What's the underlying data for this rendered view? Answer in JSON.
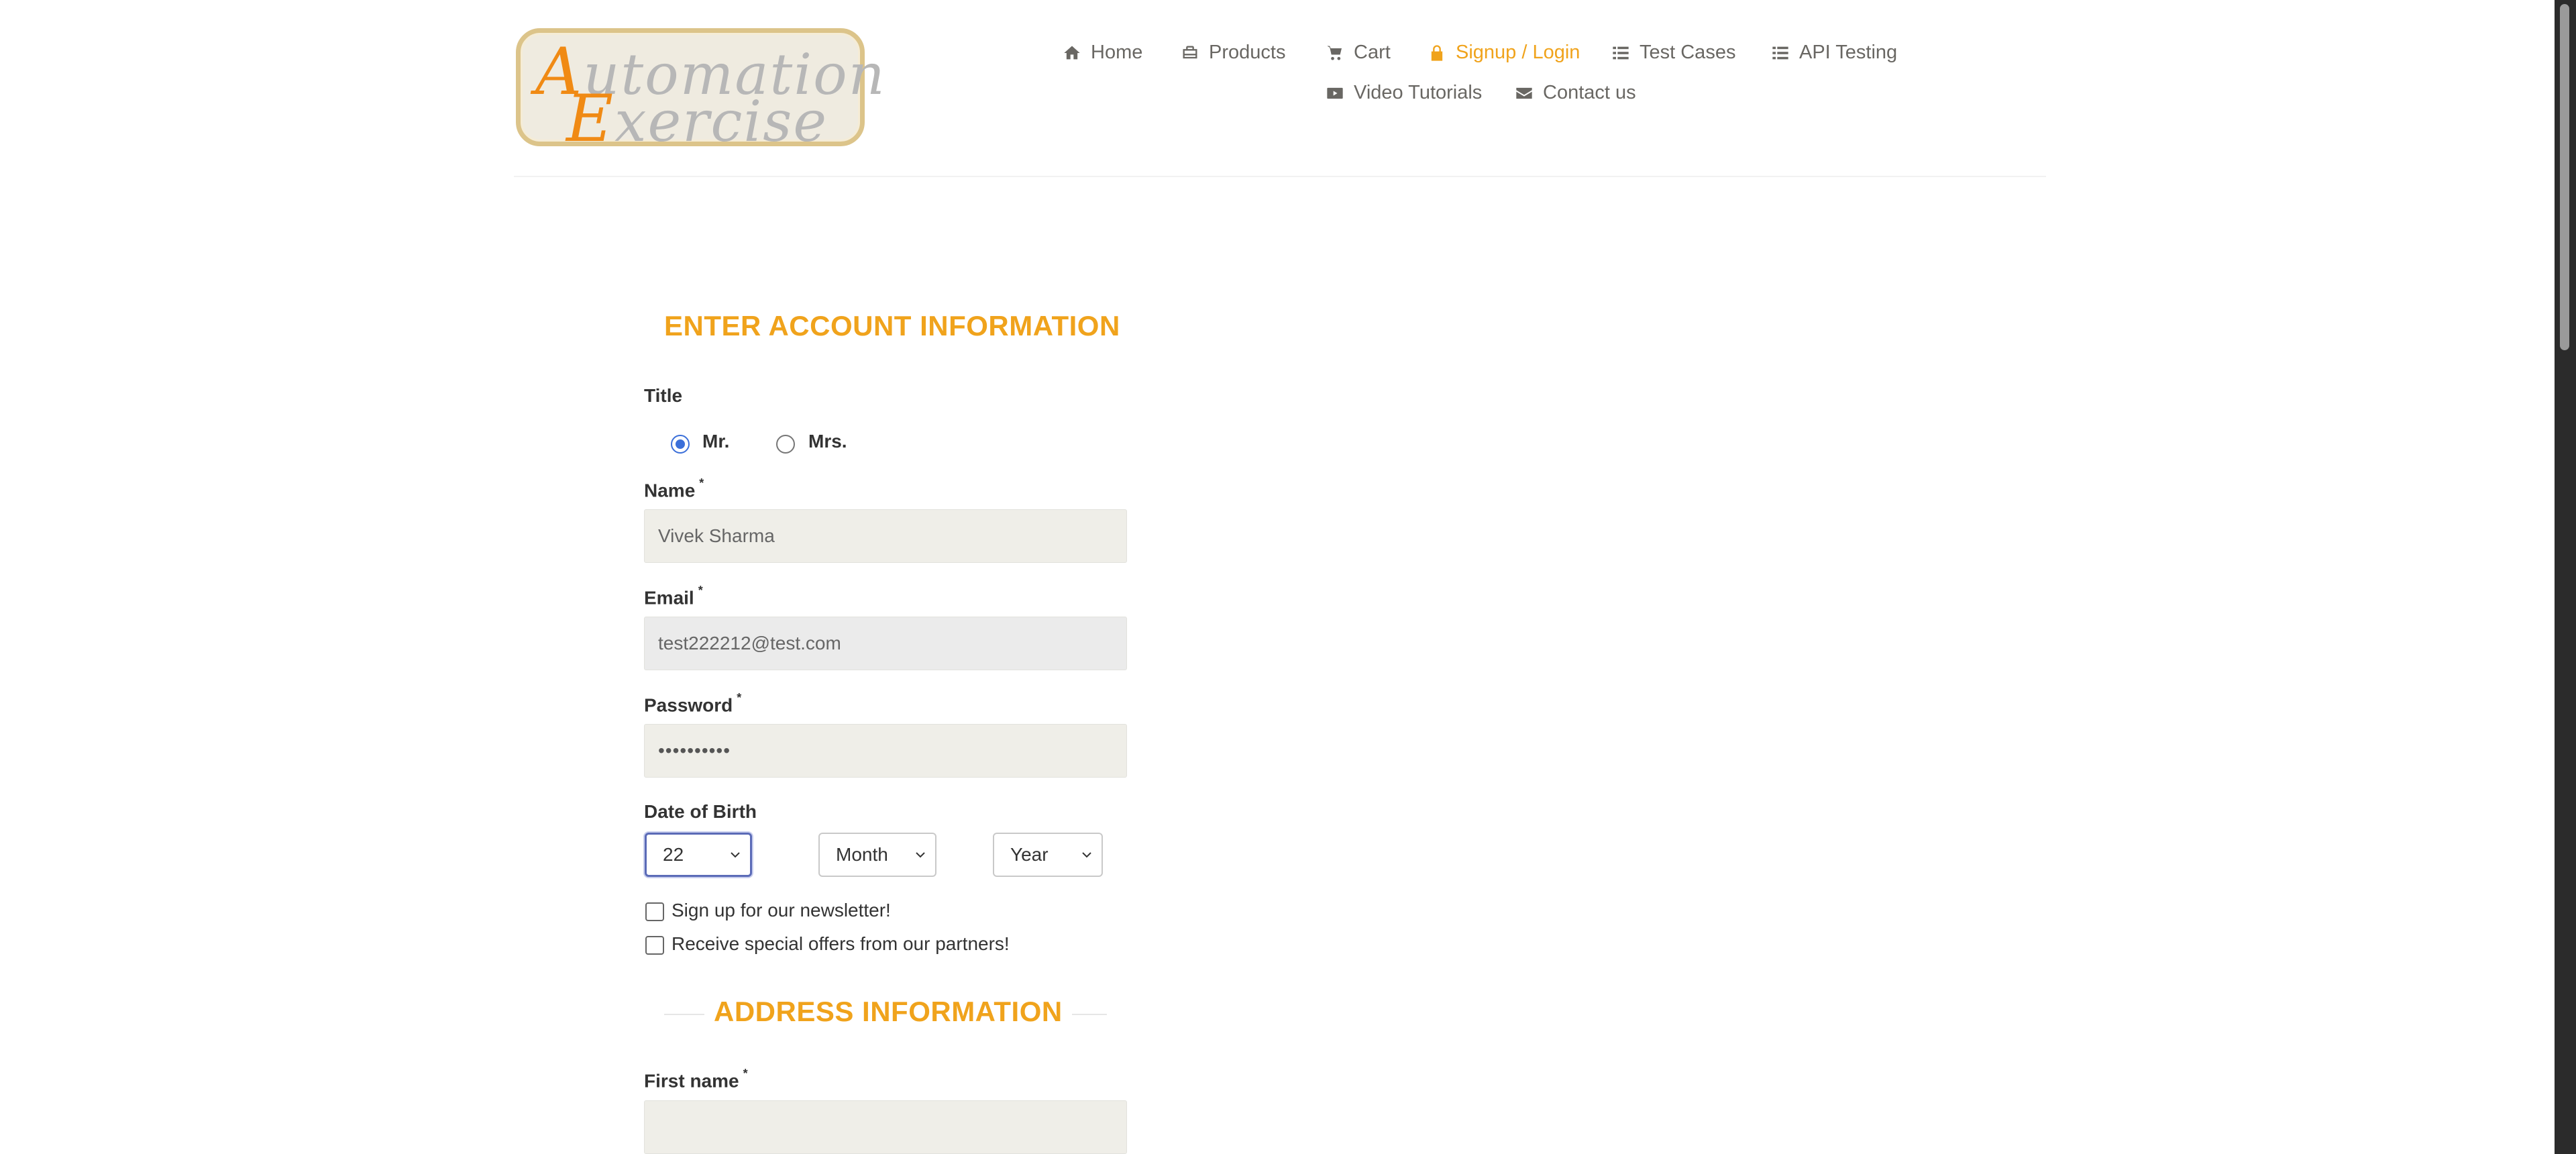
{
  "logo": {
    "line1_cap": "A",
    "line1_rest": "utomation",
    "line2_cap": "E",
    "line2_rest": "xercise",
    "colors": {
      "accent": "#f08a14",
      "text": "#b7b7b7",
      "border": "#dcc48a"
    }
  },
  "nav": {
    "home": {
      "label": "Home",
      "icon": "home-icon"
    },
    "products": {
      "label": "Products",
      "icon": "briefcase-icon"
    },
    "cart": {
      "label": "Cart",
      "icon": "cart-icon"
    },
    "signup": {
      "label": "Signup / Login",
      "icon": "lock-icon",
      "active": true
    },
    "test_cases": {
      "label": "Test Cases",
      "icon": "list-icon"
    },
    "api_testing": {
      "label": "API Testing",
      "icon": "list-icon"
    },
    "video_tutorials": {
      "label": "Video Tutorials",
      "icon": "youtube-icon"
    },
    "contact": {
      "label": "Contact us",
      "icon": "envelope-icon"
    }
  },
  "form": {
    "account_title": "ENTER ACCOUNT INFORMATION",
    "title_label": "Title",
    "title_options": {
      "mr": "Mr.",
      "mrs": "Mrs.",
      "selected": "Mr."
    },
    "name": {
      "label": "Name",
      "required": "*",
      "value": "Vivek Sharma"
    },
    "email": {
      "label": "Email",
      "required": "*",
      "value": "test222212@test.com"
    },
    "password": {
      "label": "Password",
      "required": "*",
      "value": "••••••••••"
    },
    "dob": {
      "label": "Date of Birth",
      "day": "22",
      "month": "Month",
      "year": "Year"
    },
    "newsletter_label": "Sign up for our newsletter!",
    "offers_label": "Receive special offers from our partners!",
    "address_title": "ADDRESS INFORMATION",
    "first_name": {
      "label": "First name",
      "required": "*",
      "value": ""
    }
  },
  "colors": {
    "accent": "#f0a31c",
    "focus": "#5b6bb7",
    "radio_checked": "#3b6fd9"
  }
}
